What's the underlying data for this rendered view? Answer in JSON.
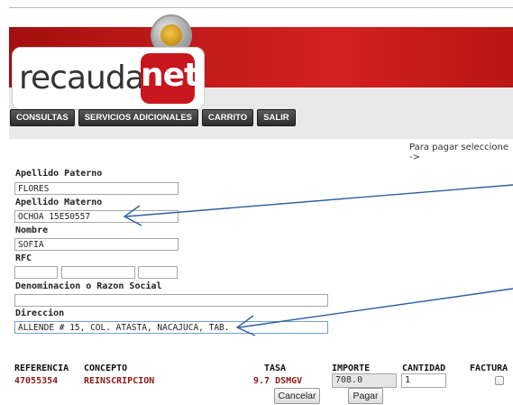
{
  "brand": {
    "logo_left": "recauda",
    "logo_right": "net"
  },
  "nav": [
    {
      "label": "CONSULTAS"
    },
    {
      "label": "SERVICIOS ADICIONALES"
    },
    {
      "label": "CARRITO"
    },
    {
      "label": "SALIR"
    }
  ],
  "hint": "Para pagar seleccione ->",
  "form": {
    "apellido_paterno": {
      "label": "Apellido Paterno",
      "value": "FLORES"
    },
    "apellido_materno": {
      "label": "Apellido Materno",
      "value": "OCHOA 15E50557"
    },
    "nombre": {
      "label": "Nombre",
      "value": "SOFIA"
    },
    "rfc": {
      "label": "RFC",
      "part1": "",
      "part2": "",
      "part3": ""
    },
    "razon_social": {
      "label": "Denominacion o Razon Social",
      "value": ""
    },
    "direccion": {
      "label": "Direccion",
      "value": "ALLENDE # 15, COL. ATASTA, NACAJUCA, TAB."
    }
  },
  "table": {
    "headers": {
      "referencia": "REFERENCIA",
      "concepto": "CONCEPTO",
      "tasa": "TASA",
      "importe": "IMPORTE",
      "cantidad": "CANTIDAD",
      "factura": "FACTURA"
    },
    "row": {
      "referencia": "47055354",
      "concepto": "REINSCRIPCION",
      "tasa": "9.7 DSMGV",
      "importe": "708.0",
      "cantidad": "1",
      "factura": false
    }
  },
  "buttons": {
    "cancel": "Cancelar",
    "pay": "Pagar"
  },
  "colors": {
    "brand_red": "#c11a1a",
    "value_text": "#8b1a1a",
    "arrow": "#2f5f9e"
  }
}
